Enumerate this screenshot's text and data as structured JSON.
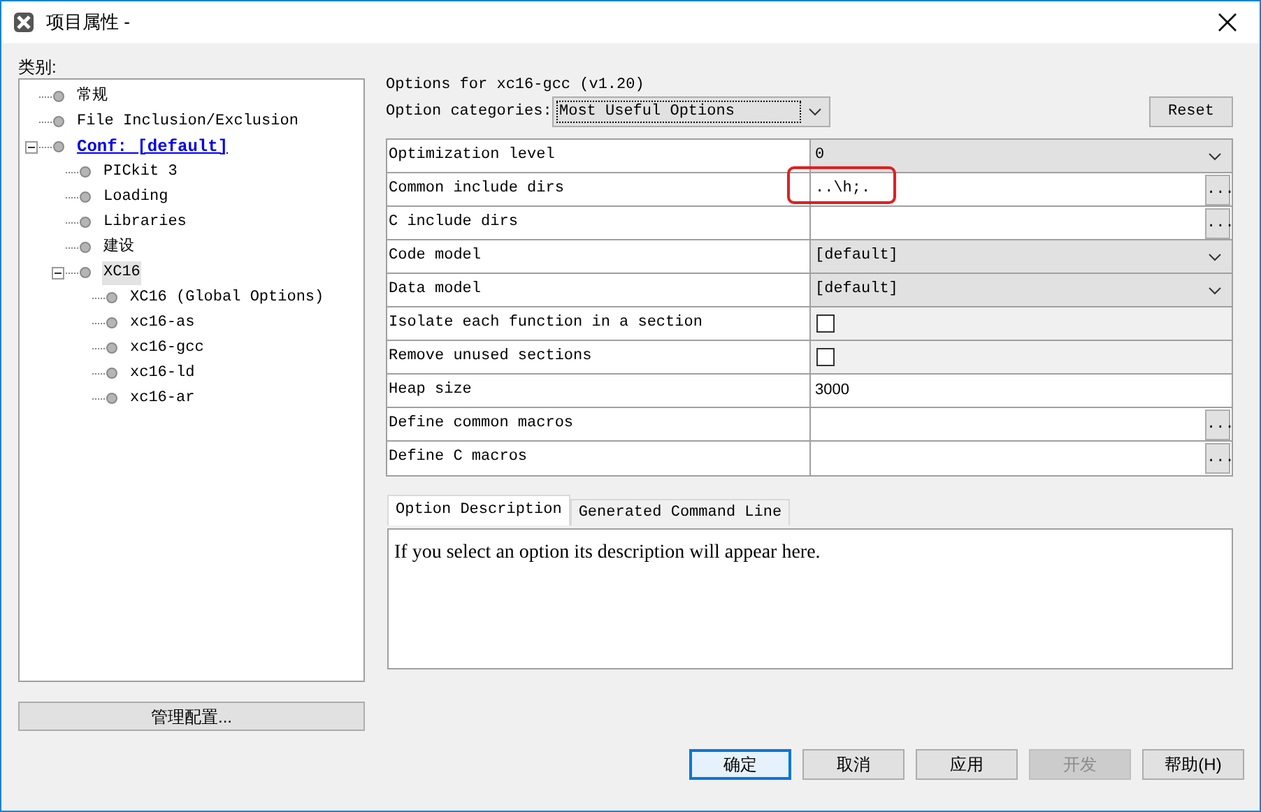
{
  "window": {
    "title": "项目属性 -"
  },
  "categories_label": "类别:",
  "tree": [
    {
      "label": "常规",
      "selected": false
    },
    {
      "label": "File Inclusion/Exclusion",
      "selected": false
    },
    {
      "label": "Conf: [default]",
      "selected": false,
      "active": true,
      "expanded": true,
      "children": [
        {
          "label": "PICkit 3",
          "selected": false
        },
        {
          "label": "Loading",
          "selected": false
        },
        {
          "label": "Libraries",
          "selected": false
        },
        {
          "label": "建设",
          "selected": false
        },
        {
          "label": "XC16",
          "selected": true,
          "expanded": true,
          "children": [
            {
              "label": "XC16 (Global Options)",
              "selected": false
            },
            {
              "label": "xc16-as",
              "selected": false
            },
            {
              "label": "xc16-gcc",
              "selected": false
            },
            {
              "label": "xc16-ld",
              "selected": false
            },
            {
              "label": "xc16-ar",
              "selected": false
            }
          ]
        }
      ]
    }
  ],
  "manage_button": "管理配置...",
  "options_title": "Options for xc16-gcc (v1.20)",
  "option_categories": {
    "label": "Option categories:",
    "value": "Most Useful Options"
  },
  "reset_button": "Reset",
  "options": [
    {
      "kind": "select",
      "label": "Optimization level",
      "value": "0"
    },
    {
      "kind": "browse",
      "label": "Common include dirs",
      "value": "..\\h;.",
      "highlighted": true
    },
    {
      "kind": "browse",
      "label": "C include dirs"
    },
    {
      "kind": "select",
      "label": "Code model",
      "value": "[default]"
    },
    {
      "kind": "select",
      "label": "Data model",
      "value": "[default]"
    },
    {
      "kind": "checkbox",
      "label": "Isolate each function in a section",
      "checked": false
    },
    {
      "kind": "checkbox",
      "label": "Remove unused sections",
      "checked": false
    },
    {
      "kind": "text",
      "label": "Heap size",
      "value": "3000"
    },
    {
      "kind": "browse",
      "label": "Define common macros"
    },
    {
      "kind": "browse",
      "label": "Define C macros"
    }
  ],
  "browse_button": "...",
  "tabs": [
    {
      "label": "Option Description",
      "selected": true
    },
    {
      "label": "Generated Command Line",
      "selected": false
    }
  ],
  "description": "If you select an option its description will appear here.",
  "buttons": [
    {
      "label": "确定",
      "default": true,
      "disabled": false
    },
    {
      "label": "取消",
      "default": false,
      "disabled": false
    },
    {
      "label": "应用",
      "default": false,
      "disabled": false
    },
    {
      "label": "开发",
      "default": false,
      "disabled": true
    },
    {
      "label": "帮助(H)",
      "default": false,
      "disabled": false
    }
  ]
}
